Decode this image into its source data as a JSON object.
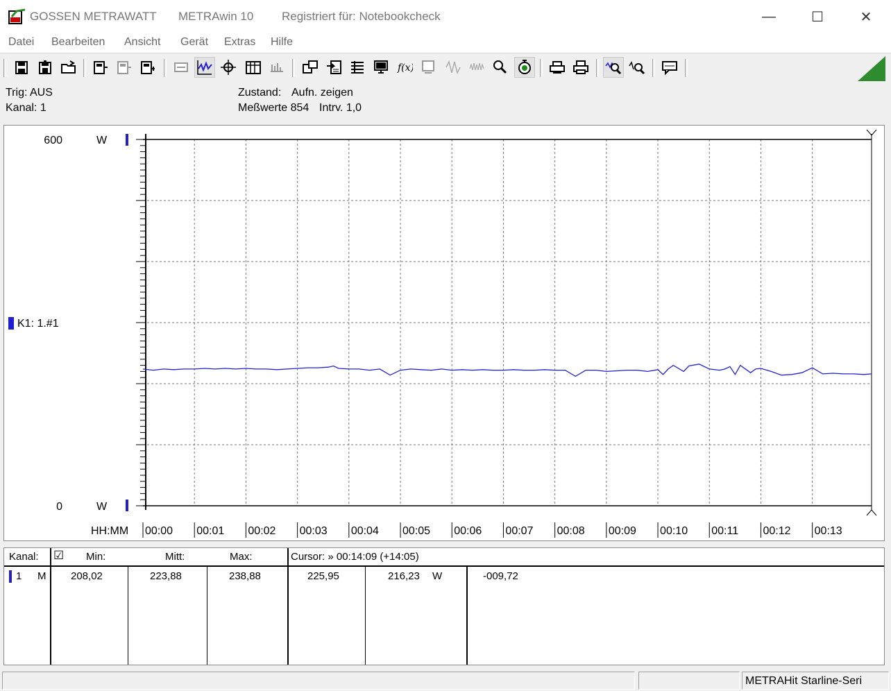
{
  "window": {
    "vendor": "GOSSEN METRAWATT",
    "app": "METRAwin 10",
    "registered": "Registriert für: Notebookcheck",
    "minimize": "—",
    "maximize": "☐",
    "close": "✕"
  },
  "menu": [
    "Datei",
    "Bearbeiten",
    "Ansicht",
    "Gerät",
    "Extras",
    "Hilfe"
  ],
  "info": {
    "trig": "Trig: AUS",
    "kanal": "Kanal: 1",
    "zustand_label": "Zustand:",
    "zustand_value": "Aufn. zeigen",
    "messwerte": "Meßwerte 854",
    "intrv": "Intrv. 1,0"
  },
  "chart_data": {
    "type": "line",
    "y_top_label": "600",
    "y_bottom_label": "0",
    "y_unit": "W",
    "ylim": [
      0,
      600
    ],
    "channel_label": "K1: 1.#1",
    "x_axis_label": "HH:MM",
    "x_ticks": [
      "00:00",
      "00:01",
      "00:02",
      "00:03",
      "00:04",
      "00:05",
      "00:06",
      "00:07",
      "00:08",
      "00:09",
      "00:10",
      "00:11",
      "00:12",
      "00:13"
    ],
    "xlim_minutes": [
      0,
      14.15
    ],
    "grid": true,
    "line_color": "#2020d0",
    "series": [
      {
        "x_minutes": [
          0,
          0.2,
          0.4,
          0.6,
          0.8,
          1,
          1.2,
          1.4,
          1.6,
          1.8,
          2,
          2.2,
          2.4,
          2.6,
          2.8,
          3,
          3.2,
          3.4,
          3.6,
          3.7,
          3.8,
          4,
          4.2,
          4.4,
          4.6,
          4.8,
          5,
          5.2,
          5.4,
          5.6,
          5.8,
          6,
          6.2,
          6.4,
          6.6,
          6.8,
          7,
          7.2,
          7.4,
          7.6,
          7.8,
          8,
          8.2,
          8.4,
          8.6,
          8.8,
          9,
          9.2,
          9.4,
          9.6,
          9.8,
          10,
          10.1,
          10.2,
          10.3,
          10.5,
          10.6,
          10.8,
          11,
          11.2,
          11.3,
          11.4,
          11.5,
          11.6,
          11.8,
          11.9,
          12,
          12.2,
          12.4,
          12.6,
          12.8,
          13,
          13.2,
          13.4,
          13.6,
          13.8,
          14,
          14.15
        ],
        "values": [
          224,
          222,
          224,
          223,
          224,
          224,
          225,
          224,
          225,
          224,
          225,
          224,
          224,
          223,
          224,
          225,
          226,
          226,
          227,
          229,
          225,
          224,
          224,
          222,
          224,
          214,
          222,
          224,
          223,
          222,
          224,
          222,
          223,
          222,
          223,
          222,
          222,
          223,
          222,
          222,
          223,
          222,
          222,
          212,
          222,
          222,
          220,
          221,
          222,
          222,
          220,
          223,
          215,
          224,
          230,
          220,
          229,
          232,
          224,
          222,
          224,
          228,
          215,
          230,
          218,
          224,
          225,
          220,
          214,
          215,
          218,
          226,
          216,
          217,
          216,
          216,
          215,
          216
        ]
      }
    ]
  },
  "table": {
    "headers": {
      "kanal": "Kanal:",
      "check": "☑",
      "min": "Min:",
      "mitt": "Mitt:",
      "max": "Max:",
      "cursor": "Cursor: » 00:14:09 (+14:05)"
    },
    "row": {
      "channel": "1",
      "mode": "M",
      "min": "208,02",
      "mitt": "223,88",
      "max": "238,88",
      "cursor1": "225,95",
      "cursor2": "216,23",
      "unit": "W",
      "delta": "-009,72"
    }
  },
  "status": {
    "device": "METRAHit Starline-Seri"
  }
}
